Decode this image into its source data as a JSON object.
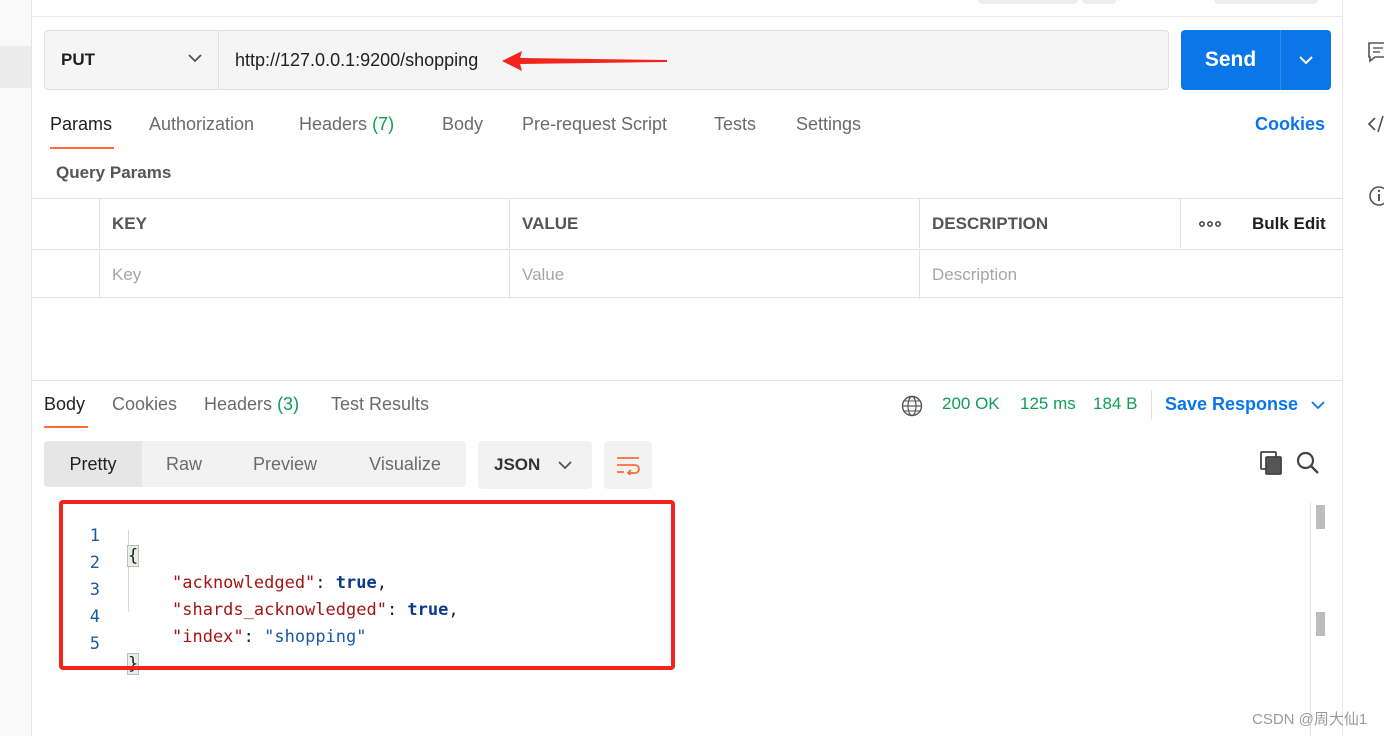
{
  "request": {
    "method": "PUT",
    "url": "http://127.0.0.1:9200/shopping",
    "send_label": "Send"
  },
  "request_tabs": [
    {
      "label": "Params",
      "active": true
    },
    {
      "label": "Authorization"
    },
    {
      "label": "Headers",
      "count": "(7)"
    },
    {
      "label": "Body"
    },
    {
      "label": "Pre-request Script"
    },
    {
      "label": "Tests"
    },
    {
      "label": "Settings"
    }
  ],
  "cookies_link": "Cookies",
  "query_params": {
    "title": "Query Params",
    "headers": {
      "key": "KEY",
      "value": "VALUE",
      "description": "DESCRIPTION",
      "bulk_edit": "Bulk Edit"
    },
    "placeholders": {
      "key": "Key",
      "value": "Value",
      "description": "Description"
    }
  },
  "response_tabs": [
    {
      "label": "Body",
      "active": true
    },
    {
      "label": "Cookies"
    },
    {
      "label": "Headers",
      "count": "(3)"
    },
    {
      "label": "Test Results"
    }
  ],
  "status": {
    "code": "200 OK",
    "time": "125 ms",
    "size": "184 B"
  },
  "save_response": "Save Response",
  "view_modes": [
    "Pretty",
    "Raw",
    "Preview",
    "Visualize"
  ],
  "format": "JSON",
  "code_lines": [
    {
      "n": "1",
      "text": "{"
    },
    {
      "n": "2",
      "key": "\"acknowledged\"",
      "sep": ": ",
      "val": "true",
      "end": ","
    },
    {
      "n": "3",
      "key": "\"shards_acknowledged\"",
      "sep": ": ",
      "val": "true",
      "end": ","
    },
    {
      "n": "4",
      "key": "\"index\"",
      "sep": ": ",
      "str": "\"shopping\""
    },
    {
      "n": "5",
      "text": "}"
    }
  ],
  "watermark": "CSDN @周大仙1",
  "colors": {
    "accent": "#0b76e8",
    "tab_underline": "#ff6c37",
    "success": "#0f9d58",
    "annotation": "#f2241b"
  },
  "icons": [
    "chevron-down-icon",
    "globe-icon",
    "copy-icon",
    "search-icon",
    "wrap-lines-icon",
    "comment-icon",
    "code-icon",
    "info-icon",
    "more-icon",
    "red-arrow-annotation"
  ]
}
